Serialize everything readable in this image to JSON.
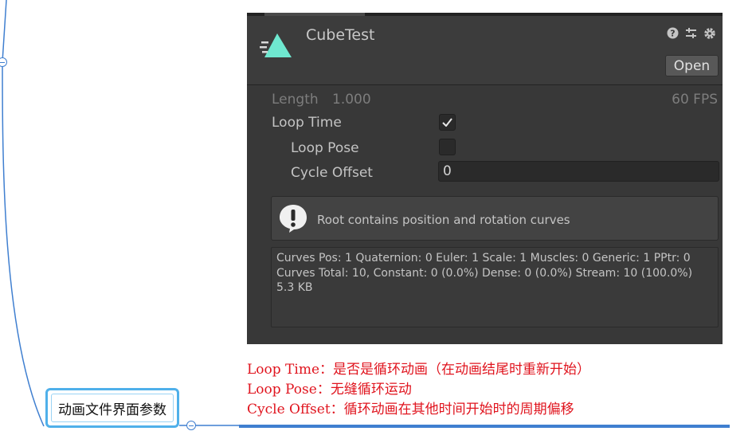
{
  "mindmap": {
    "node_label": "动画文件界面参数"
  },
  "inspector": {
    "title": "CubeTest",
    "open_label": "Open",
    "header_icons": [
      "help-icon",
      "preset-icon",
      "settings-icon"
    ],
    "length_label": "Length",
    "length_value": "1.000",
    "fps_label": "60 FPS",
    "loop_time_label": "Loop Time",
    "loop_time_checked": true,
    "loop_pose_label": "Loop Pose",
    "loop_pose_checked": false,
    "cycle_offset_label": "Cycle Offset",
    "cycle_offset_value": "0",
    "help_message": "Root contains position and rotation curves",
    "info_lines": [
      "Curves Pos: 1 Quaternion: 0 Euler: 1 Scale: 1 Muscles: 0 Generic: 1 PPtr: 0",
      "Curves Total: 10, Constant: 0 (0.0%) Dense: 0 (0.0%) Stream: 10 (100.0%)",
      "5.3 KB"
    ]
  },
  "notes": [
    "Loop Time：是否是循环动画（在动画结尾时重新开始）",
    "Loop Pose：无缝循环运动",
    "Cycle Offset：循环动画在其他时间开始时的周期偏移"
  ],
  "colors": {
    "note_red": "#e0141e",
    "mindmap_blue": "#3f7fd0",
    "node_border": "#4fb0ea",
    "anim_icon": "#6fe8d0"
  }
}
